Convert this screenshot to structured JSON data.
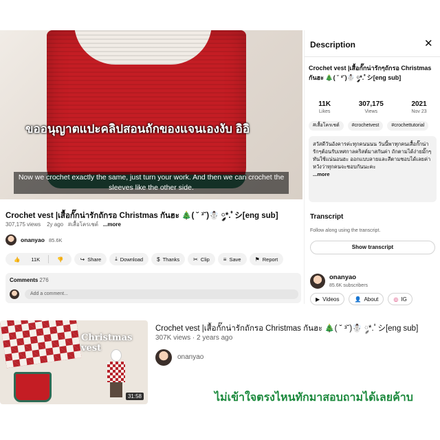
{
  "player": {
    "thai_caption": "ขออนุญาตแปะคลิปสอนถักของแจนเองงับ อิอิ",
    "subtitle": "Now we crochet exactly the same, just turn your work. And then we can crochet the sleeves like the other side."
  },
  "video": {
    "title": "Crochet vest |เสื้อกั๊กน่ารักถักรอ Christmas กันฮะ 🎄( ˘ ³˘)☃️ ༘*.ﾟシ[eng sub]",
    "views": "307,175 views",
    "age": "2y ago",
    "hashtag": "#เสื้อโครเชต์",
    "more": "...more",
    "channel": "onanyao",
    "subscribers": "85.6K"
  },
  "actions": {
    "likes": "11K",
    "share": "Share",
    "download": "Download",
    "thanks": "Thanks",
    "clip": "Clip",
    "save": "Save",
    "report": "Report"
  },
  "comments": {
    "label": "Comments",
    "count": "276",
    "placeholder": "Add a comment..."
  },
  "panel": {
    "title": "Description",
    "video_title": "Crochet vest |เสื้อกั๊กน่ารักๆถักรอ Christmas กันฮะ 🎄( ˘ ³˘)☃️ ༘*.ﾟシ[eng sub]",
    "stats": [
      {
        "value": "11K",
        "label": "Likes"
      },
      {
        "value": "307,175",
        "label": "Views"
      },
      {
        "value": "2021",
        "label": "Nov 23"
      }
    ],
    "tags": [
      "#เสื้อโครเชต์",
      "#crochetvest",
      "#crochettutorial"
    ],
    "description": "สวัสดีวันอังคารค่ะทุกคนนนน วันนี้พาทุกคนเสื้อกั๊กน่ารักๆต้อนรับเทศกาลคริสต์มาสกันค่า ถักตามได้ง่ายมั๊กๆทันใช้แน่นอนฮะ ออกแบบลายและสีตามชอบได้เลยค่า หวังว่าทุกคนจะชอบกันนะคะ",
    "more": "...more",
    "transcript_title": "Transcript",
    "transcript_sub": "Follow along using the transcript.",
    "show_transcript": "Show transcript",
    "channel": "onanyao",
    "subscribers": "85.6K subscribers",
    "videos_btn": "Videos",
    "about_btn": "About",
    "ig_btn": "IG"
  },
  "recommended": {
    "thumb_word": "Christmas vest",
    "duration": "31:58",
    "title": "Crochet vest |เสื้อกั๊กน่ารักถักรอ Christmas กันฮะ 🎄( ˘ ³˘)☃️ ༘*.ﾟシ[eng sub]",
    "meta": "307K views · 2 years ago",
    "channel": "onanyao"
  },
  "overlay_text": "ไม่เข้าใจตรงไหนทักมาสอบถามได้เลยค้าบ"
}
